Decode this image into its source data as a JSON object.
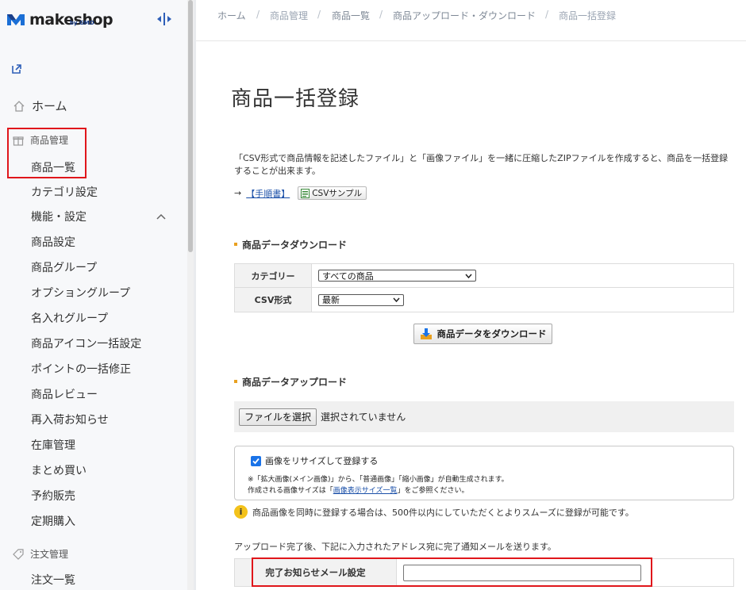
{
  "logo": {
    "text": "makeshop",
    "byline": "by GMO"
  },
  "sidebar": {
    "home": "ホーム",
    "product_section": "商品管理",
    "items": [
      "商品一覧",
      "カテゴリ設定",
      "機能・設定",
      "商品設定",
      "商品グループ",
      "オプショングループ",
      "名入れグループ",
      "商品アイコン一括設定",
      "ポイントの一括修正",
      "商品レビュー",
      "再入荷お知らせ",
      "在庫管理",
      "まとめ買い",
      "予約販売",
      "定期購入"
    ],
    "order_section": "注文管理",
    "order_items": [
      "注文一覧"
    ]
  },
  "breadcrumb": [
    "ホーム",
    "商品管理",
    "商品一覧",
    "商品アップロード・ダウンロード",
    "商品一括登録"
  ],
  "page": {
    "title": "商品一括登録",
    "description": "「CSV形式で商品情報を記述したファイル」と「画像ファイル」を一緒に圧縮したZIPファイルを作成すると、商品を一括登録することが出来ます。",
    "arrow": "→",
    "manual_link": "【手順書】",
    "csv_sample": "CSVサンプル"
  },
  "download": {
    "section_title": "商品データダウンロード",
    "category_label": "カテゴリー",
    "category_value": "すべての商品",
    "csv_label": "CSV形式",
    "csv_value": "最新",
    "button_label": "商品データをダウンロード"
  },
  "upload": {
    "section_title": "商品データアップロード",
    "file_button": "ファイルを選択",
    "file_status": "選択されていません",
    "resize_label": "画像をリサイズして登録する",
    "resize_checked": true,
    "note1": "※「拡大画像(メイン画像)」から、「普通画像」「縮小画像」が自動生成されます。",
    "note2_prefix": "作成される画像サイズは「",
    "note2_link": "画像表示サイズ一覧",
    "note2_suffix": "」をご参照ください。",
    "info_text": "商品画像を同時に登録する場合は、500件以内にしていただくとよりスムーズに登録が可能です。",
    "complete_note": "アップロード完了後、下記に入力されたアドレス宛に完了通知メールを送ります。",
    "mail_label": "完了お知らせメール設定",
    "mail_value": ""
  },
  "colors": {
    "brand_blue": "#1a73e8",
    "highlight_red": "#e0161b",
    "accent_orange": "#e8a020"
  }
}
